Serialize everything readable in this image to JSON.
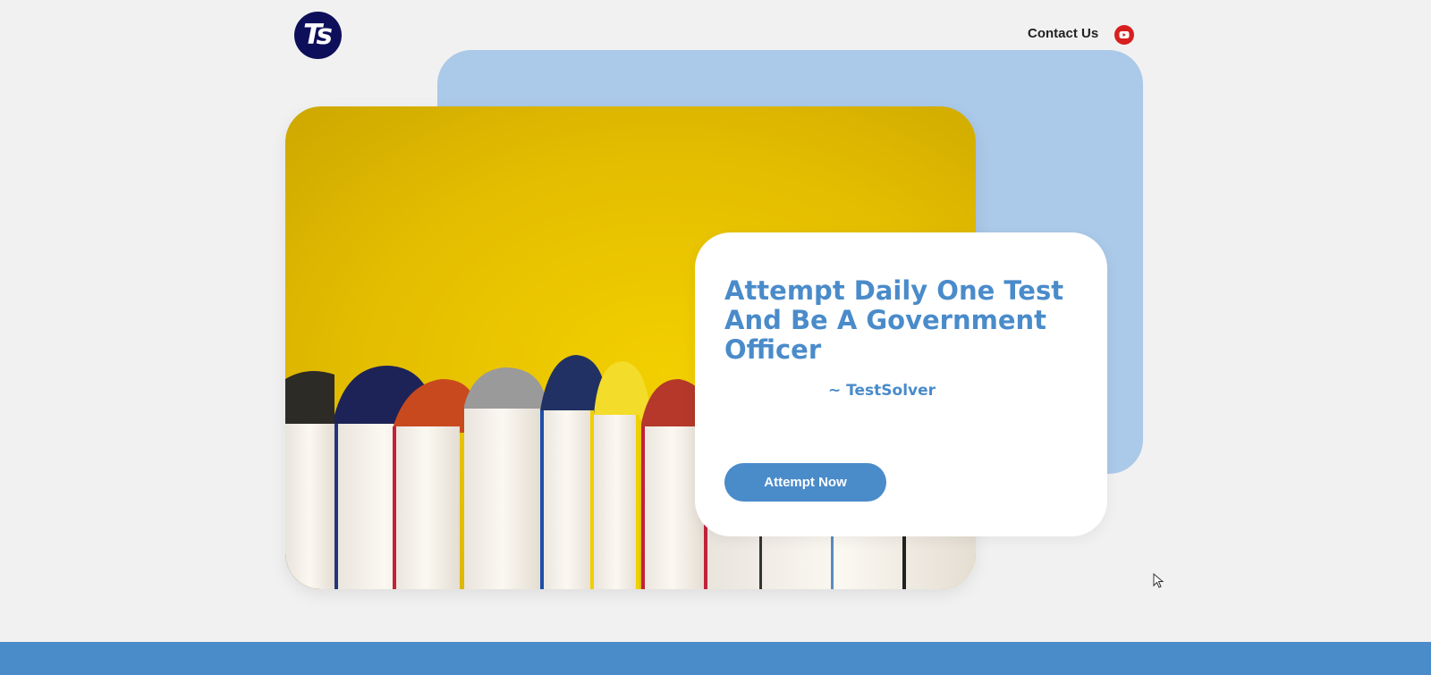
{
  "brand": {
    "logo_text": "Ts"
  },
  "nav": {
    "contact_label": "Contact Us",
    "youtube_icon": "youtube-icon"
  },
  "hero": {
    "image_subject": "books",
    "title": "Attempt Daily One Test And Be A Government Officer",
    "author": "~ TestSolver",
    "cta_label": "Attempt Now"
  },
  "colors": {
    "accent": "#4a8bca",
    "panel": "#abc9e8",
    "background": "#f1f1f1",
    "logo_bg": "#0e0f5a",
    "youtube": "#d81f1f",
    "hero_yellow": "#e8c000"
  }
}
